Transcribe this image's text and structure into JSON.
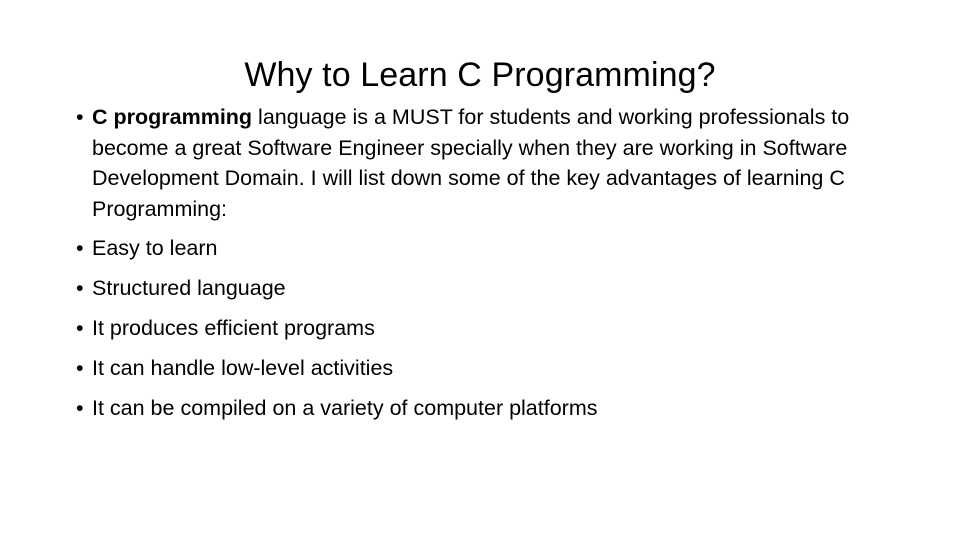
{
  "slide": {
    "title": "Why to Learn C Programming?",
    "bullet_marker": "•",
    "background_color": "#ffffff",
    "text_color": "#000000",
    "bullets": [
      {
        "type": "paragraph",
        "lead_bold": "C programming",
        "rest": " language is a MUST for students and working professionals to become a great Software Engineer specially when they are working in Software Development Domain. I will list down some of the key advantages of learning C Programming:"
      },
      {
        "type": "short",
        "text": "Easy to learn"
      },
      {
        "type": "short",
        "text": "Structured language"
      },
      {
        "type": "short",
        "text": "It produces efficient programs"
      },
      {
        "type": "short",
        "text": "It can handle low-level activities"
      },
      {
        "type": "short",
        "text": "It can be compiled on a variety of computer platforms"
      }
    ]
  }
}
